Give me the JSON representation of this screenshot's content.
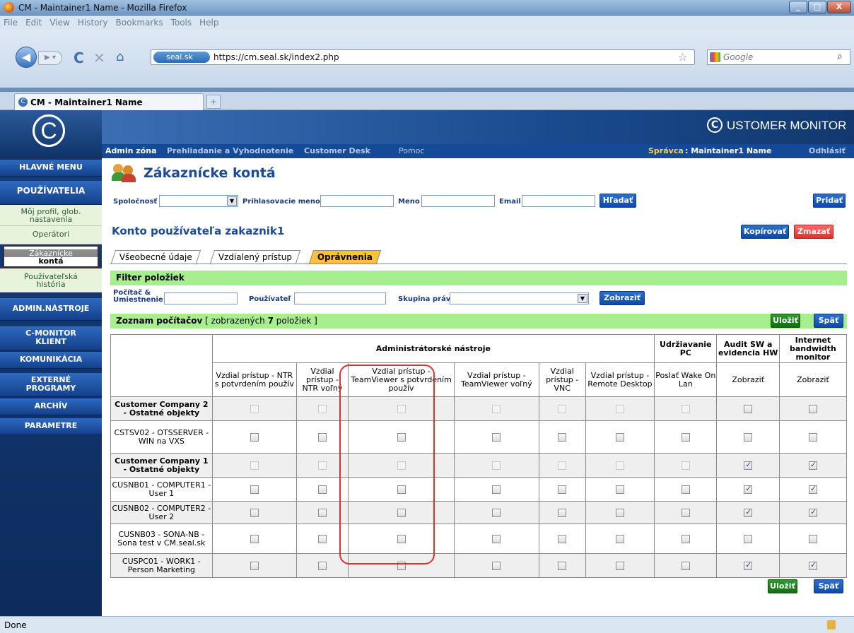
{
  "window": {
    "title": "CM - Maintainer1 Name - Mozilla Firefox",
    "minimize": "_",
    "maximize": "□",
    "close": "X"
  },
  "menu": [
    "File",
    "Edit",
    "View",
    "History",
    "Bookmarks",
    "Tools",
    "Help"
  ],
  "nav": {
    "url_site": "seal.sk",
    "url": "https://cm.seal.sk/index2.php",
    "search_placeholder": "Google"
  },
  "tab": {
    "label": "CM - Maintainer1 Name",
    "new_tab": "+"
  },
  "brand": {
    "logo_letter": "C",
    "name": "USTOMER MONITOR"
  },
  "adminbar": {
    "admin_zone": "Admin zóna",
    "review": "Prehliadanie a Vyhodnotenie",
    "desk": "Customer Desk",
    "help": "Pomoc",
    "admin_label": "Správca",
    "admin_name": ": Maintainer1 Name",
    "logout": "Odhlásiť"
  },
  "sidebar": {
    "main_menu": "HLAVNÉ MENU",
    "users": "POUŽÍVATELIA",
    "profile_line1": "Môj profil, glob.",
    "profile_line2": "nastavenia",
    "operators": "Operátori",
    "customer_line1": "Zákaznícke",
    "customer_line2": "kontá",
    "history_line1": "Používateľská",
    "history_line2": "história",
    "admin_tools": "ADMIN.NÁSTROJE",
    "cmonitor_line1": "C-MONITOR",
    "cmonitor_line2": "KLIENT",
    "communication": "KOMUNIKÁCIA",
    "external_line1": "EXTERNÉ",
    "external_line2": "PROGRAMY",
    "archive": "ARCHÍV",
    "parameters": "PARAMETRE"
  },
  "page": {
    "title": "Zákaznícke kontá",
    "account_title": "Konto používateľa zakaznik1"
  },
  "search": {
    "company": "Spoločnosť",
    "login": "Prihlasovacie meno",
    "name": "Meno",
    "email": "Email",
    "search_btn": "Hľadať",
    "add_btn": "Pridať"
  },
  "actions": {
    "copy": "Kopírovať",
    "delete": "Zmazať",
    "save": "Uložiť",
    "back": "Späť"
  },
  "tabs": [
    "Všeobecné údaje",
    "Vzdialený prístup",
    "Oprávnenia"
  ],
  "filter": {
    "title": "Filter položiek",
    "computer_line1": "Počítač &",
    "computer_line2": "Umiestnenie",
    "user": "Používateľ",
    "rights": "Skupina práv",
    "show_btn": "Zobraziť"
  },
  "list": {
    "title": "Zoznam počítačov",
    "shown": " [ zobrazených ",
    "count": "7",
    "items": " položiek ]"
  },
  "table": {
    "group_admin": "Administrátorské nástroje",
    "group_maint": "Udržiavanie PC",
    "group_audit": "Audit SW a evidencia HW",
    "group_internet": "Internet bandwidth monitor",
    "cols": [
      "Vzdial prístup - NTR s potvrdením použív",
      "Vzdial prístup - NTR voľný",
      "Vzdial prístup - TeamViewer s potvrdením použív",
      "Vzdial prístup - TeamViewer voľný",
      "Vzdial prístup - VNC",
      "Vzdial prístup - Remote Desktop",
      "Poslať Wake On Lan",
      "Zobraziť",
      "Zobraziť"
    ],
    "rows": [
      {
        "name": "Customer Company 2 - Ostatné objekty",
        "group": true,
        "checks": [
          "d",
          "d",
          "d",
          "d",
          "d",
          "d",
          "d",
          "o",
          "o"
        ]
      },
      {
        "name": "CSTSV02 - OTSSERVER - WIN na VXS",
        "group": false,
        "checks": [
          "o",
          "o",
          "o",
          "o",
          "o",
          "o",
          "o",
          "o",
          "o"
        ]
      },
      {
        "name": "Customer Company 1 - Ostatné objekty",
        "group": true,
        "checks": [
          "d",
          "d",
          "d",
          "d",
          "d",
          "d",
          "d",
          "x",
          "x"
        ]
      },
      {
        "name": "CUSNB01 - COMPUTER1 - User 1",
        "group": false,
        "checks": [
          "o",
          "o",
          "o",
          "o",
          "o",
          "o",
          "o",
          "x",
          "x"
        ]
      },
      {
        "name": "CUSNB02 - COMPUTER2 - User 2",
        "group": false,
        "checks": [
          "o",
          "o",
          "o",
          "o",
          "o",
          "o",
          "o",
          "x",
          "x"
        ]
      },
      {
        "name": "CUSNB03 - SONA-NB - Sona test v CM.seal.sk",
        "group": false,
        "checks": [
          "o",
          "o",
          "o",
          "o",
          "o",
          "o",
          "o",
          "o",
          "o"
        ]
      },
      {
        "name": "CUSPC01 - WORK1 - Person Marketing",
        "group": false,
        "checks": [
          "o",
          "o",
          "o",
          "o",
          "o",
          "o",
          "o",
          "x",
          "x"
        ]
      }
    ]
  },
  "status": {
    "text": "Done"
  },
  "colors": {
    "accent": "#154a98",
    "green_bar": "#a6ee8e",
    "highlight_box": "#e03030"
  }
}
